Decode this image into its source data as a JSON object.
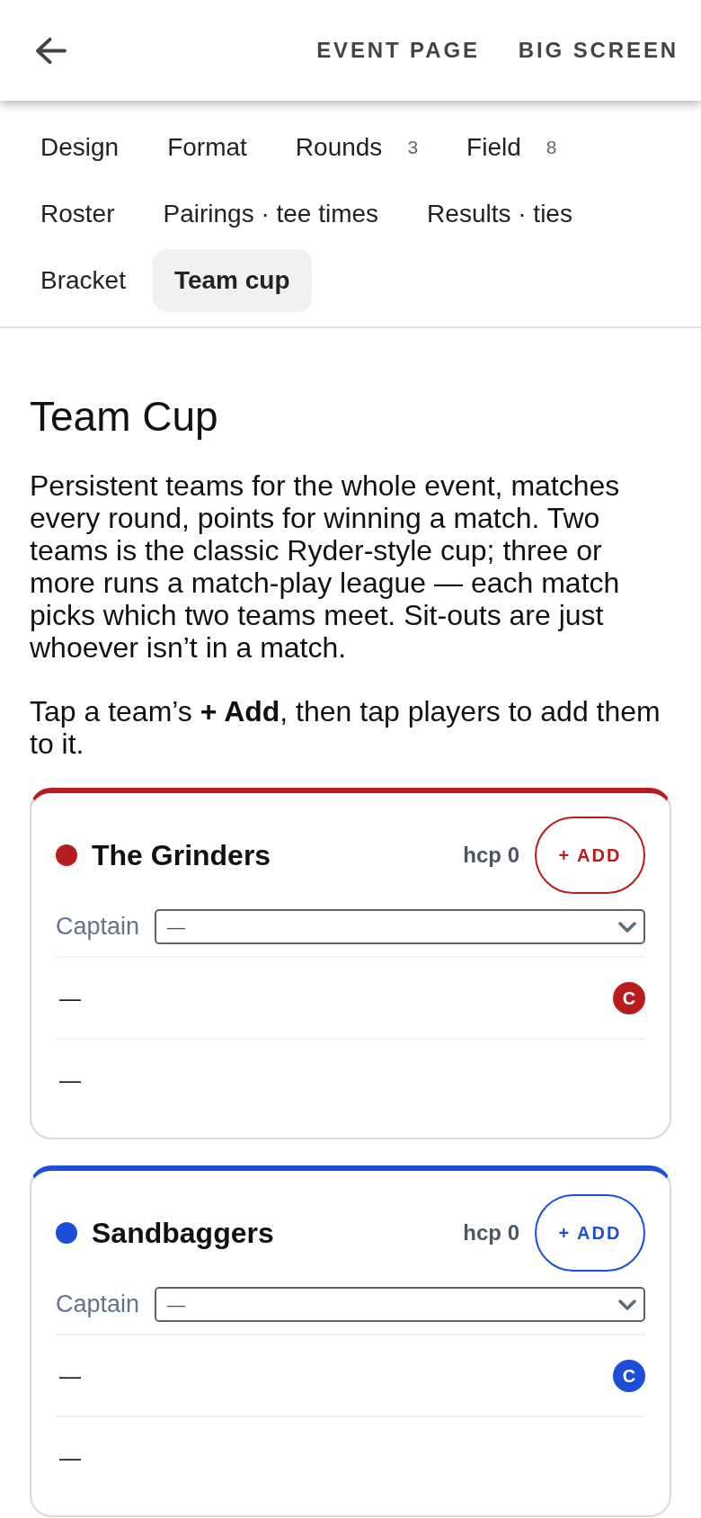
{
  "header": {
    "actions": [
      "EVENT PAGE",
      "BIG SCREEN"
    ]
  },
  "tabs": [
    {
      "label": "Design",
      "selected": false
    },
    {
      "label": "Format",
      "selected": false
    },
    {
      "label": "Rounds",
      "count": "3",
      "selected": false
    },
    {
      "label": "Field",
      "count": "8",
      "selected": false
    },
    {
      "label": "Roster",
      "selected": false
    },
    {
      "label": "Pairings · tee times",
      "selected": false
    },
    {
      "label": "Results · ties",
      "selected": false
    },
    {
      "label": "Bracket",
      "selected": false
    },
    {
      "label": "Team cup",
      "selected": true
    }
  ],
  "section": {
    "title": "Team Cup",
    "description": "Persistent teams for the whole event, matches every round, points for winning a match. Two teams is the classic Ryder-style cup; three or more runs a match-play league — each match picks which two teams meet. Sit-outs are just whoever isn’t in a match.",
    "instruction": "Tap a team’s **+ Add**, then tap players to add them to it."
  },
  "teams": [
    {
      "name": "The Grinders",
      "color": "#b91c1c",
      "handicap": "hcp 0",
      "add_label": "+ ADD",
      "captain_label": "Captain",
      "captain_value": "—",
      "players": [
        {
          "name": "—",
          "badge": "C"
        },
        {
          "name": "—"
        }
      ]
    },
    {
      "name": "Sandbaggers",
      "color": "#1d4ed8",
      "handicap": "hcp 0",
      "add_label": "+ ADD",
      "captain_label": "Captain",
      "captain_value": "—",
      "players": [
        {
          "name": "—",
          "badge": "C"
        },
        {
          "name": "—"
        }
      ]
    }
  ]
}
